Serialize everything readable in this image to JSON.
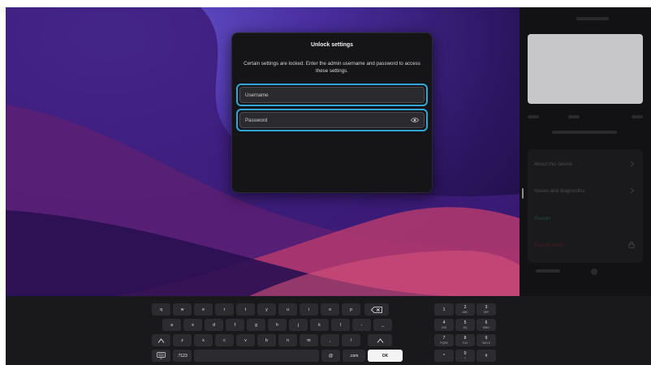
{
  "dialog": {
    "title": "Unlock settings",
    "description": "Certain settings are locked. Enter the admin username and password to access these settings.",
    "username_placeholder": "Username",
    "password_placeholder": "Password"
  },
  "sidebar": {
    "items": [
      {
        "label": "About this device",
        "color": "#4c4c52"
      },
      {
        "label": "Issues and diagnostics",
        "color": "#4c4c52"
      },
      {
        "label": "Restart",
        "color": "#1f4d2e"
      },
      {
        "label": "Factory reset",
        "color": "#4a1a1a"
      }
    ]
  },
  "keyboard": {
    "row1": [
      "q",
      "w",
      "e",
      "r",
      "t",
      "y",
      "u",
      "i",
      "o",
      "p"
    ],
    "row2": [
      "a",
      "s",
      "d",
      "f",
      "g",
      "h",
      "j",
      "k",
      "l",
      "-",
      "_"
    ],
    "row3": [
      "z",
      "x",
      "c",
      "v",
      "b",
      "n",
      "m",
      ",",
      "/"
    ],
    "row4": {
      "numbers_label": ".?123",
      "at_label": "@",
      "com_label": ".com",
      "ok_label": "OK"
    },
    "numpad": [
      {
        "main": "1",
        "sub": ""
      },
      {
        "main": "2",
        "sub": "ABC"
      },
      {
        "main": "3",
        "sub": "DEF"
      },
      {
        "main": "4",
        "sub": "GHI"
      },
      {
        "main": "5",
        "sub": "JKL"
      },
      {
        "main": "6",
        "sub": "MNO"
      },
      {
        "main": "7",
        "sub": "PQRS"
      },
      {
        "main": "8",
        "sub": "TUV"
      },
      {
        "main": "9",
        "sub": "WXYZ"
      },
      {
        "main": "*",
        "sub": ""
      },
      {
        "main": "0",
        "sub": "+"
      },
      {
        "main": "#",
        "sub": ""
      }
    ]
  },
  "colors": {
    "accent": "#2fa6d8",
    "dialog_bg": "#151518",
    "keyboard_bg": "#19191c",
    "key_bg": "#2c2c30"
  }
}
